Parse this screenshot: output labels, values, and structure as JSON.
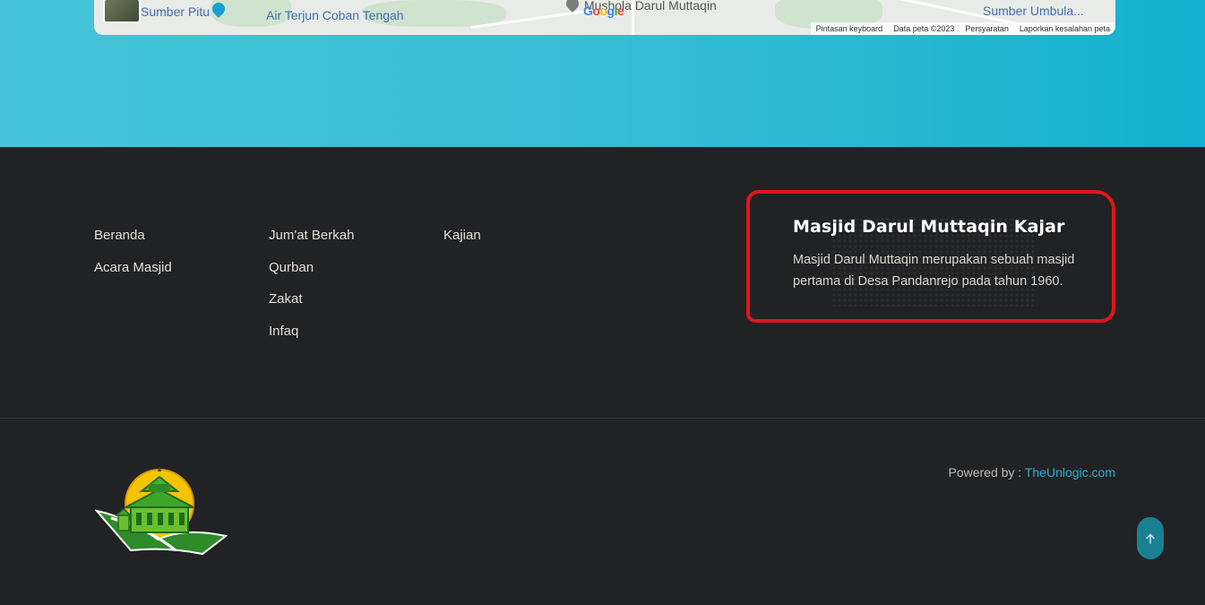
{
  "map": {
    "labels": {
      "sumber_pitu": "Sumber Pitu",
      "air_terjun": "Air Terjun Coban Tengah",
      "mushola": "Mushola Darul Muttaqin",
      "sumber_umbul": "Sumber Umbula..."
    },
    "logo": "Google",
    "footer": {
      "shortcuts": "Pintasan keyboard",
      "map_data": "Data peta ©2023",
      "terms": "Persyaratan",
      "report": "Laporkan kesalahan peta"
    }
  },
  "footer_nav": {
    "col1": [
      "Beranda",
      "Acara Masjid"
    ],
    "col2": [
      "Jum'at Berkah",
      "Qurban",
      "Zakat",
      "Infaq"
    ],
    "col3": [
      "Kajian"
    ]
  },
  "about": {
    "title": "Masjid Darul Muttaqin Kajar",
    "text": "Masjid Darul Muttaqin merupakan sebuah masjid pertama di Desa Pandanrejo pada tahun 1960."
  },
  "powered": {
    "prefix": "Powered by : ",
    "link": "TheUnlogic.com"
  },
  "icons": {
    "back_to_top": "arrow-up-icon",
    "camera_pin": "camera-pin-icon",
    "place_pin": "place-pin-icon"
  },
  "colors": {
    "footer_bg": "#212224",
    "teal_band": "#36bdd6",
    "link_accent": "#25b3d1",
    "highlight": "#e0161b",
    "to_top_button": "#1b7f93"
  }
}
